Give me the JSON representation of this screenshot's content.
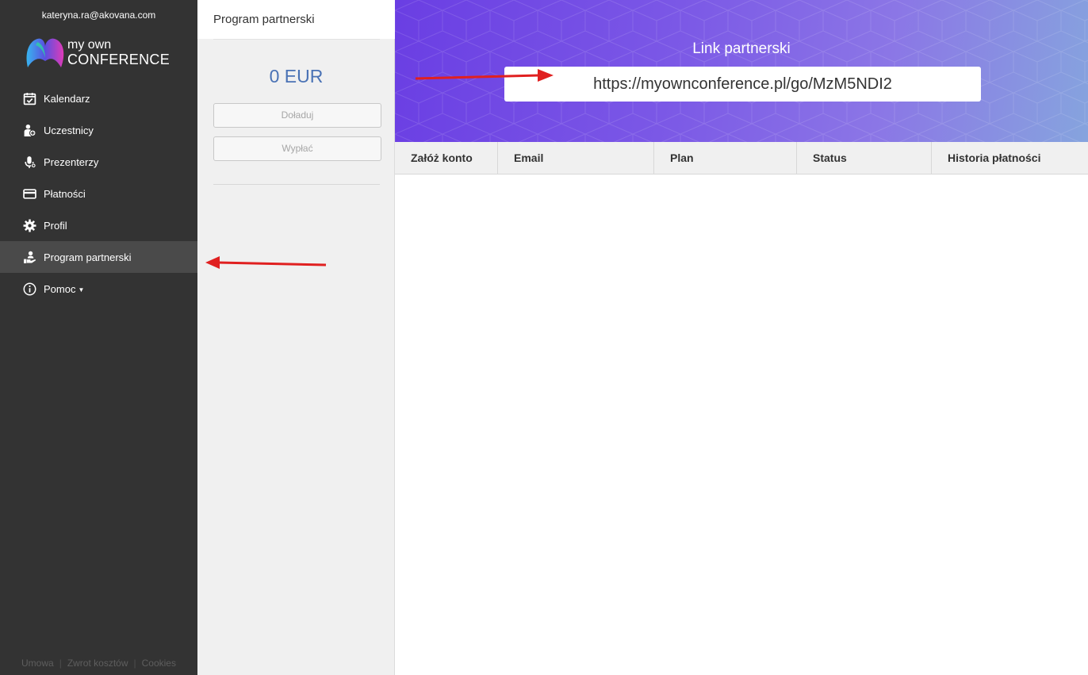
{
  "user": {
    "email": "kateryna.ra@akovana.com"
  },
  "logo": {
    "line1": "my own",
    "line2": "CONFERENCE"
  },
  "sidebar": {
    "items": [
      {
        "label": "Kalendarz",
        "icon": "calendar-check-icon"
      },
      {
        "label": "Uczestnicy",
        "icon": "user-add-icon"
      },
      {
        "label": "Prezenterzy",
        "icon": "microphone-icon"
      },
      {
        "label": "Płatności",
        "icon": "credit-card-icon"
      },
      {
        "label": "Profil",
        "icon": "gear-icon"
      },
      {
        "label": "Program partnerski",
        "icon": "hand-user-icon",
        "active": true
      },
      {
        "label": "Pomoc",
        "icon": "info-circle-icon",
        "dropdown": true
      }
    ],
    "footer": [
      "Umowa",
      "Zwrot kosztów",
      "Cookies"
    ]
  },
  "middle": {
    "title": "Program partnerski",
    "balance": "0 EUR",
    "topup_label": "Doładuj",
    "withdraw_label": "Wypłać"
  },
  "banner": {
    "title": "Link partnerski",
    "link": "https://myownconference.pl/go/MzM5NDI2"
  },
  "table": {
    "columns": [
      "Załóż konto",
      "Email",
      "Plan",
      "Status",
      "Historia płatności"
    ],
    "rows": []
  },
  "colors": {
    "sidebar_bg": "#333333",
    "sidebar_active": "#4a4a4a",
    "balance": "#4a72b5",
    "banner_start": "#6a3ee3",
    "banner_end": "#86a4de",
    "annotation_arrow": "#e02020"
  }
}
